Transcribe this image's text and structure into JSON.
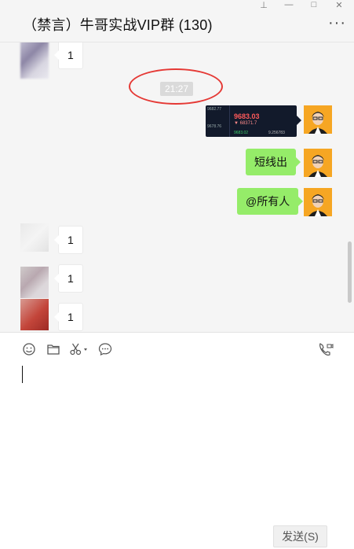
{
  "window": {
    "title": "（禁言）牛哥实战VIP群 (130)",
    "controls": [
      "pin-icon",
      "minimize-icon",
      "maximize-icon",
      "close-icon"
    ],
    "more_label": "···"
  },
  "chat": {
    "timestamp": "21:27",
    "messages": [
      {
        "side": "left",
        "text": "1"
      },
      {
        "side": "right",
        "type": "image",
        "image_values": [
          "9683.03",
          "9682.77",
          "9678.76",
          "▼ 68371.7",
          "9683.02",
          "9.256783"
        ]
      },
      {
        "side": "right",
        "text": "短线出"
      },
      {
        "side": "right",
        "text": "@所有人"
      },
      {
        "side": "left",
        "text": "1"
      },
      {
        "side": "left",
        "text": "1"
      },
      {
        "side": "left",
        "text": "1"
      }
    ]
  },
  "toolbar": {
    "icons": [
      "emoji-icon",
      "folder-icon",
      "scissors-icon",
      "chat-history-icon",
      "video-call-icon"
    ]
  },
  "composer": {
    "send_label": "发送(S)"
  },
  "colors": {
    "my_bubble": "#95ec69",
    "highlight_circle": "#e53935"
  }
}
